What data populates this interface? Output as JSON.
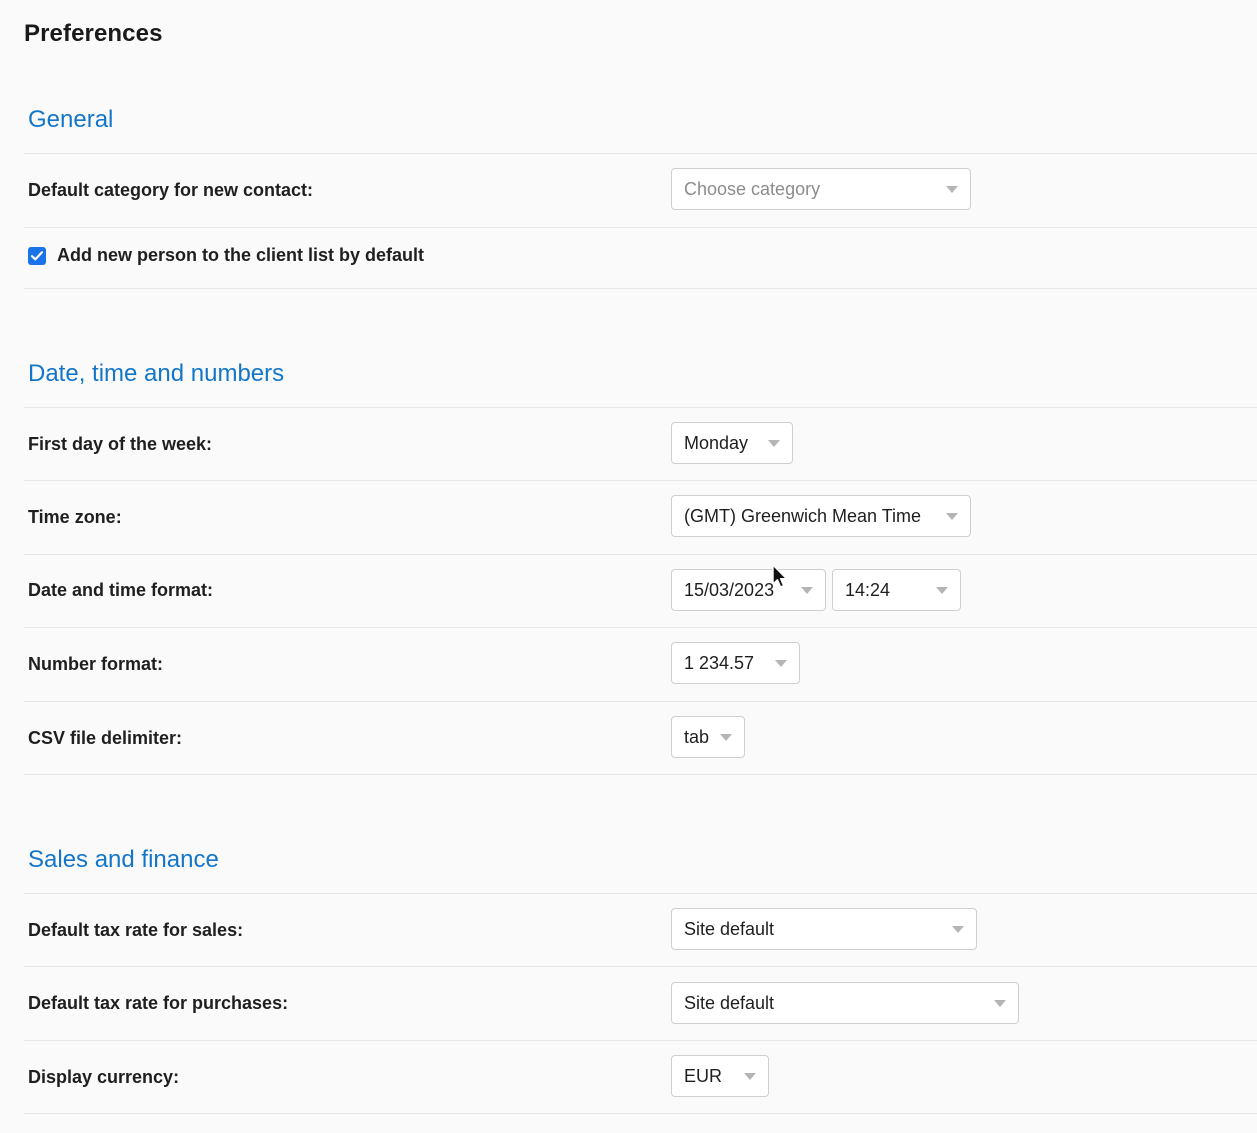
{
  "page": {
    "title": "Preferences"
  },
  "sections": {
    "general": {
      "title": "General",
      "default_category": {
        "label": "Default category for new contact:",
        "placeholder": "Choose category"
      },
      "add_to_client_list": {
        "label": "Add new person to the client list by default",
        "checked": true
      }
    },
    "datetime": {
      "title": "Date, time and numbers",
      "first_day": {
        "label": "First day of the week:",
        "value": "Monday"
      },
      "time_zone": {
        "label": "Time zone:",
        "value": "(GMT) Greenwich Mean Time"
      },
      "date_time_format": {
        "label": "Date and time format:",
        "date_value": "15/03/2023",
        "time_value": "14:24"
      },
      "number_format": {
        "label": "Number format:",
        "value": "1 234.57"
      },
      "csv_delimiter": {
        "label": "CSV file delimiter:",
        "value": "tab"
      }
    },
    "sales": {
      "title": "Sales and finance",
      "tax_sales": {
        "label": "Default tax rate for sales:",
        "value": "Site default"
      },
      "tax_purchases": {
        "label": "Default tax rate for purchases:",
        "value": "Site default"
      },
      "display_currency": {
        "label": "Display currency:",
        "value": "EUR"
      }
    }
  },
  "icons": {
    "dropdown": "chevron-down-icon",
    "checkbox": "check-icon",
    "cursor": "mouse-pointer-icon"
  },
  "colors": {
    "section_title": "#1476c8",
    "checkbox": "#1a73e8",
    "background": "#fafafa"
  }
}
